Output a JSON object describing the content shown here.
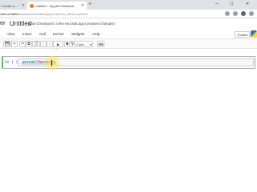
{
  "browser": {
    "tabs": [
      {
        "title": "I create a ...",
        "active": false
      },
      {
        "title": "Untitled - Jupyter Notebook",
        "active": true
      }
    ],
    "new_tab": "+",
    "url_host": "calhost:8888",
    "url_path": "/notebooks/Untitled.ipynb?kernel_name=python3",
    "window_controls": {
      "minimize": "—",
      "maximize": "☐",
      "close": "✕"
    }
  },
  "jupyter": {
    "logo_fragment": "er",
    "notebook_title": "Untitled",
    "checkpoint": "Last Checkpoint: a few seconds ago",
    "unsaved": "(unsaved changes)",
    "menu": [
      "View",
      "Insert",
      "Cell",
      "Kernel",
      "Widgets",
      "Help"
    ],
    "trusted": "Trusted",
    "toolbar": {
      "save": "💾",
      "add": "+",
      "cut": "✂",
      "copy": "⧉",
      "paste": "📋",
      "up": "↑",
      "down": "↓",
      "run": "▶ Run",
      "stop": "■",
      "restart": "↻",
      "fast_forward": "⏩",
      "cell_type": "Code",
      "caret": "▾",
      "keyboard": "⌨"
    },
    "cell": {
      "prompt": "In [ ]:",
      "code_fn": "print",
      "code_open": "(",
      "code_str": "\"Inside\"",
      "code_close": ")"
    }
  },
  "colors": {
    "accent_active_cell": "#66bb6a",
    "prompt": "#303f9f",
    "selection": "#c8ddf9"
  }
}
